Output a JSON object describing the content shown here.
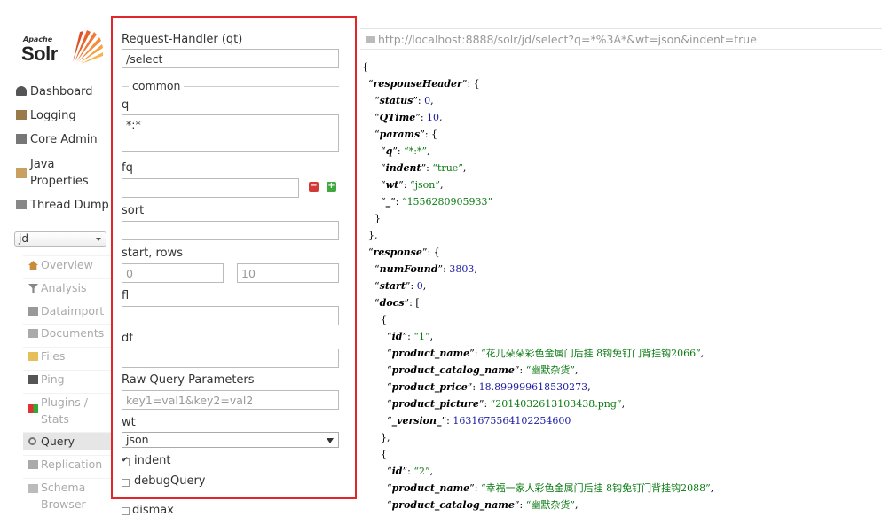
{
  "logo": {
    "apache": "Apache",
    "solr": "Solr"
  },
  "nav": [
    {
      "label": "Dashboard",
      "icon": "dashboard-icon"
    },
    {
      "label": "Logging",
      "icon": "logging-icon"
    },
    {
      "label": "Core Admin",
      "icon": "core-admin-icon"
    },
    {
      "label": "Java",
      "label2": "Properties",
      "icon": "java-icon"
    },
    {
      "label": "Thread Dump",
      "icon": "thread-dump-icon"
    }
  ],
  "core_selector": {
    "value": "jd"
  },
  "core_menu": [
    {
      "label": "Overview",
      "icon": "home-icon"
    },
    {
      "label": "Analysis",
      "icon": "filter-icon"
    },
    {
      "label": "Dataimport",
      "icon": "dataimport-icon"
    },
    {
      "label": "Documents",
      "icon": "documents-icon"
    },
    {
      "label": "Files",
      "icon": "folder-icon"
    },
    {
      "label": "Ping",
      "icon": "ping-icon"
    },
    {
      "label": "Plugins /",
      "label2": "Stats",
      "icon": "plugins-icon"
    },
    {
      "label": "Query",
      "icon": "search-icon",
      "active": true
    },
    {
      "label": "Replication",
      "icon": "replication-icon"
    },
    {
      "label": "Schema",
      "label2": "Browser",
      "icon": "schema-icon"
    }
  ],
  "query": {
    "qt_label": "Request-Handler (qt)",
    "qt_value": "/select",
    "common_legend": "common",
    "q_label": "q",
    "q_value": "*:*",
    "fq_label": "fq",
    "fq_value": "",
    "sort_label": "sort",
    "sort_value": "",
    "start_rows_label": "start, rows",
    "start_value": "0",
    "rows_value": "10",
    "fl_label": "fl",
    "fl_value": "",
    "df_label": "df",
    "df_value": "",
    "raw_label": "Raw Query Parameters",
    "raw_placeholder": "key1=val1&key2=val2",
    "wt_label": "wt",
    "wt_value": "json",
    "indent_label": "indent",
    "indent_checked": true,
    "debug_label": "debugQuery",
    "debug_checked": false,
    "dismax_label": "dismax"
  },
  "result": {
    "url": "http://localhost:8888/solr/jd/select?q=*%3A*&wt=json&indent=true",
    "responseHeader": {
      "status": "0",
      "QTime": "10",
      "q": "*:*",
      "indent": "true",
      "wt": "json",
      "_": "1556280905933"
    },
    "response": {
      "numFound": "3803",
      "start": "0",
      "docs": [
        {
          "id": "1",
          "product_name": "花儿朵朵彩色金属门后挂 8钩免钉门背挂钩2066",
          "product_catalog_name": "幽默杂货",
          "product_price": "18.899999618530273",
          "product_picture": "2014032613103438.png",
          "_version_": "1631675564102254600"
        },
        {
          "id": "2",
          "product_name": "幸福一家人彩色金属门后挂 8钩免钉门背挂钩2088",
          "product_catalog_name": "幽默杂货"
        }
      ]
    }
  }
}
